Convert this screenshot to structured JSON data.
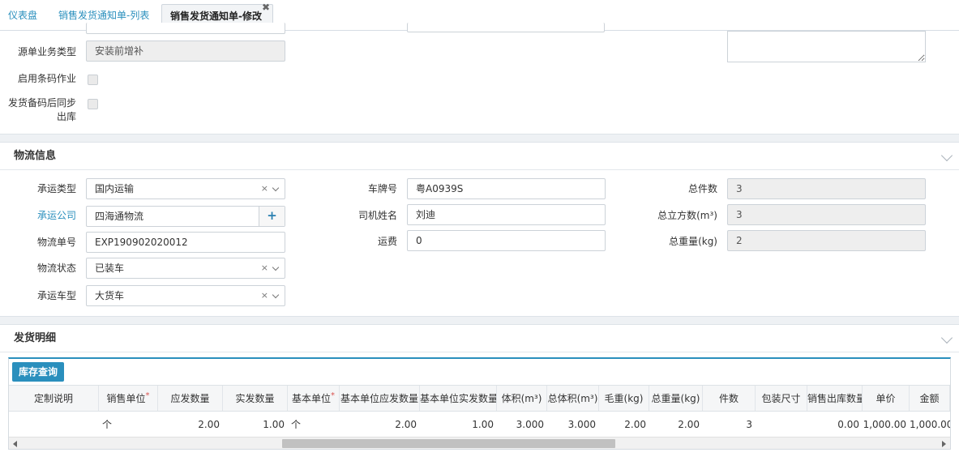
{
  "tabs": [
    {
      "label": "仪表盘"
    },
    {
      "label": "销售发货通知单-列表"
    },
    {
      "label": "销售发货通知单-修改"
    }
  ],
  "top_section": {
    "source_biz_type_label": "源单业务类型",
    "source_biz_type_value": "安装前增补",
    "enable_barcode_label": "启用条码作业",
    "sync_outbound_label_line1": "发货备码后同步",
    "sync_outbound_label_line2": "出库"
  },
  "logistics": {
    "title": "物流信息",
    "carrier_type_label": "承运类型",
    "carrier_type_value": "国内运输",
    "carrier_company_label": "承运公司",
    "carrier_company_value": "四海通物流",
    "tracking_no_label": "物流单号",
    "tracking_no_value": "EXP190902020012",
    "logistics_status_label": "物流状态",
    "logistics_status_value": "已装车",
    "vehicle_type_label": "承运车型",
    "vehicle_type_value": "大货车",
    "plate_no_label": "车牌号",
    "plate_no_value": "粤A0939S",
    "driver_name_label": "司机姓名",
    "driver_name_value": "刘迪",
    "freight_label": "运费",
    "freight_value": "0",
    "total_pieces_label": "总件数",
    "total_pieces_value": "3",
    "total_volume_label": "总立方数(m³)",
    "total_volume_value": "3",
    "total_weight_label": "总重量(kg)",
    "total_weight_value": "2",
    "clear_glyph": "×",
    "add_glyph": "+"
  },
  "details": {
    "title": "发货明细",
    "stock_query_button": "库存查询",
    "columns": [
      {
        "label": "定制说明",
        "required": false
      },
      {
        "label": "销售单位",
        "required": true
      },
      {
        "label": "应发数量",
        "required": false
      },
      {
        "label": "实发数量",
        "required": false
      },
      {
        "label": "基本单位",
        "required": true
      },
      {
        "label": "基本单位应发数量",
        "required": false
      },
      {
        "label": "基本单位实发数量",
        "required": false
      },
      {
        "label": "体积(m³)",
        "required": false
      },
      {
        "label": "总体积(m³)",
        "required": false
      },
      {
        "label": "毛重(kg)",
        "required": false
      },
      {
        "label": "总重量(kg)",
        "required": false
      },
      {
        "label": "件数",
        "required": false
      },
      {
        "label": "包装尺寸",
        "required": false
      },
      {
        "label": "销售出库数量",
        "required": false
      },
      {
        "label": "单价",
        "required": false
      },
      {
        "label": "金额",
        "required": false
      }
    ],
    "rows": [
      [
        "",
        "个",
        "2.00",
        "1.00",
        "个",
        "2.00",
        "1.00",
        "3.000",
        "3.000",
        "2.00",
        "2.00",
        "3",
        "",
        "0.00",
        "1,000.00",
        "1,000.00"
      ]
    ],
    "required_mark": "*"
  }
}
